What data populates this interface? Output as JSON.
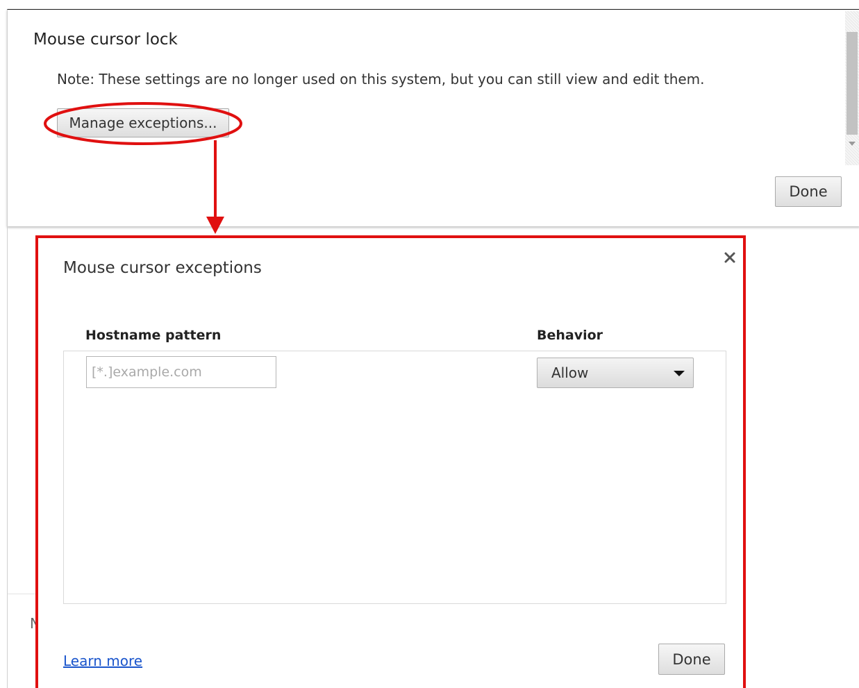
{
  "settings_section": {
    "title": "Mouse cursor lock",
    "note": "Note: These settings are no longer used on this system, but you can still view and edit them.",
    "manage_button_label": "Manage exceptions...",
    "done_label": "Done"
  },
  "exceptions_dialog": {
    "title": "Mouse cursor exceptions",
    "close_icon": "close-icon",
    "columns": {
      "hostname": "Hostname pattern",
      "behavior": "Behavior"
    },
    "new_entry": {
      "hostname_placeholder": "[*.]example.com",
      "hostname_value": "",
      "behavior_selected": "Allow"
    },
    "learn_more_label": "Learn more",
    "done_label": "Done"
  },
  "background": {
    "partial_glyph": "N"
  },
  "colors": {
    "annotation_red": "#e01010",
    "link_blue": "#1a55cc"
  }
}
